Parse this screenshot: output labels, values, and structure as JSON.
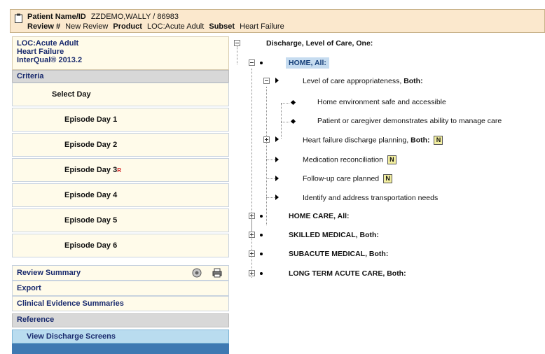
{
  "header": {
    "patient_label": "Patient Name/ID",
    "patient_value": "ZZDEMO,WALLY / 86983",
    "review_label": "Review #",
    "review_value": "New Review",
    "product_label": "Product",
    "product_value": "LOC:Acute Adult",
    "subset_label": "Subset",
    "subset_value": "Heart Failure"
  },
  "left": {
    "loc_line1": "LOC:Acute Adult",
    "loc_line2": "Heart Failure",
    "loc_line3": "InterQual® 2013.2",
    "criteria_header": "Criteria",
    "select_day": "Select Day",
    "days": [
      "Episode Day 1",
      "Episode Day 2",
      "Episode Day 3",
      "Episode Day 4",
      "Episode Day 5",
      "Episode Day 6"
    ],
    "day3_marker": "R",
    "review_summary": "Review Summary",
    "export": "Export",
    "clinical_evidence": "Clinical Evidence Summaries",
    "reference_header": "Reference",
    "view_discharge": "View Discharge Screens"
  },
  "tree": {
    "root": "Discharge, Level of Care, One:",
    "home_all": "HOME, All:",
    "loc_approp": "Level of care appropriateness,",
    "loc_approp_bold": "Both:",
    "home_env": "Home environment safe and accessible",
    "patient_caregiver": "Patient or caregiver demonstrates ability to manage care",
    "hf_discharge": "Heart failure discharge planning,",
    "hf_discharge_bold": "Both:",
    "med_recon": "Medication reconciliation",
    "followup": "Follow-up care planned",
    "transport": "Identify and address transportation needs",
    "note_letter": "N",
    "home_care": "HOME CARE, All:",
    "skilled": "SKILLED MEDICAL, Both:",
    "subacute": "SUBACUTE MEDICAL, Both:",
    "ltac": "LONG TERM ACUTE CARE, Both:"
  }
}
